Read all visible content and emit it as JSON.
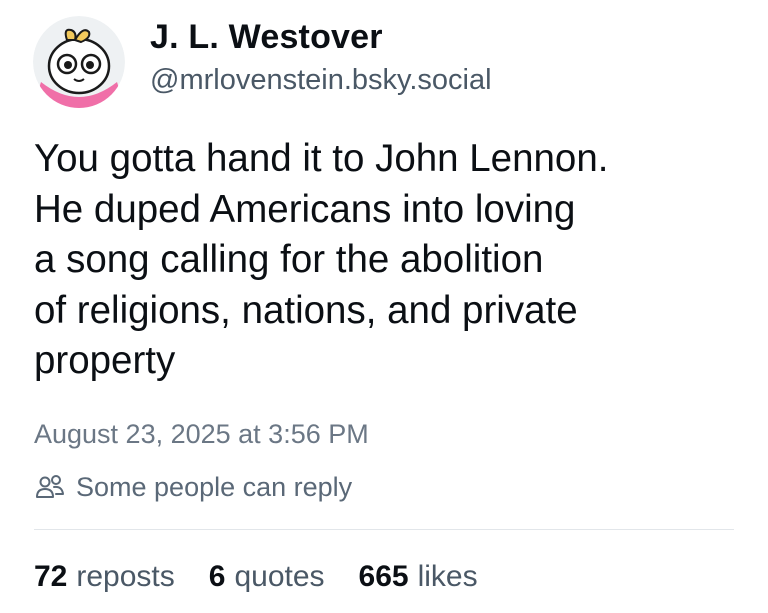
{
  "author": {
    "display_name": "J. L. Westover",
    "handle": "@mrlovenstein.bsky.social",
    "avatar_icon": "cartoon-face-avatar-icon"
  },
  "post": {
    "text_lines": [
      "You gotta hand it to John Lennon.",
      "He duped Americans into loving",
      "a song calling for the abolition",
      "of religions, nations, and private",
      "property"
    ],
    "timestamp": "August 23, 2025 at 3:56 PM",
    "reply_setting": "Some people can reply",
    "reply_icon": "people-icon"
  },
  "stats": {
    "reposts_count": "72",
    "reposts_label": "reposts",
    "quotes_count": "6",
    "quotes_label": "quotes",
    "likes_count": "665",
    "likes_label": "likes"
  },
  "colors": {
    "text": "#0b0f14",
    "muted": "#6b7785",
    "divider": "#e2e6ea",
    "avatar_accent": "#f06fa8",
    "avatar_bow": "#f2c95c"
  }
}
